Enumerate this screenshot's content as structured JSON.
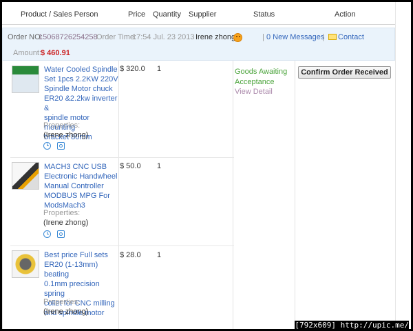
{
  "header": {
    "col_product": "Product / Sales Person",
    "col_price": "Price",
    "col_quantity": "Quantity",
    "col_supplier": "Supplier",
    "col_status": "Status",
    "col_action": "Action"
  },
  "order": {
    "number_label": "Order NO:",
    "number": "15068726254258",
    "time_label": "Order Time:",
    "time": "17:54 Jul. 23 2013",
    "supplier": "Irene zhong",
    "messages": "0 New Messages",
    "sep1": "|",
    "sep2": "|",
    "contact": "Contact",
    "amount_label": "Amount:",
    "amount": "$ 460.91",
    "status_line1": "Goods Awaiting",
    "status_line2": "Acceptance",
    "view_detail": "View Detail",
    "action_button": "Confirm Order Received"
  },
  "items": [
    {
      "title_lines": [
        "Water Cooled Spindle",
        "Set 1pcs 2.2KW 220V",
        "Spindle Motor chuck",
        "ER20 &2.2kw inverter &",
        "spindle motor mounting",
        "bracket 80mm"
      ],
      "properties": "Properties:",
      "seller": "(Irene zhong)",
      "price": "$ 320.0",
      "quantity": "1"
    },
    {
      "title_lines": [
        "MACH3 CNC USB",
        "Electronic Handwheel",
        "Manual Controller",
        "MODBUS MPG For",
        "ModsMach3"
      ],
      "properties": "Properties:",
      "seller": "(Irene zhong)",
      "price": "$ 50.0",
      "quantity": "1"
    },
    {
      "title_lines": [
        "Best price Full sets",
        "ER20 (1-13mm) beating",
        "0.1mm precision spring",
        "collet for CNC milling",
        "and spindle motor"
      ],
      "properties": "Properties:",
      "seller": "(Irene zhong)",
      "price": "$ 28.0",
      "quantity": "1"
    }
  ],
  "watermark": "[792x609] http://upic.me/"
}
